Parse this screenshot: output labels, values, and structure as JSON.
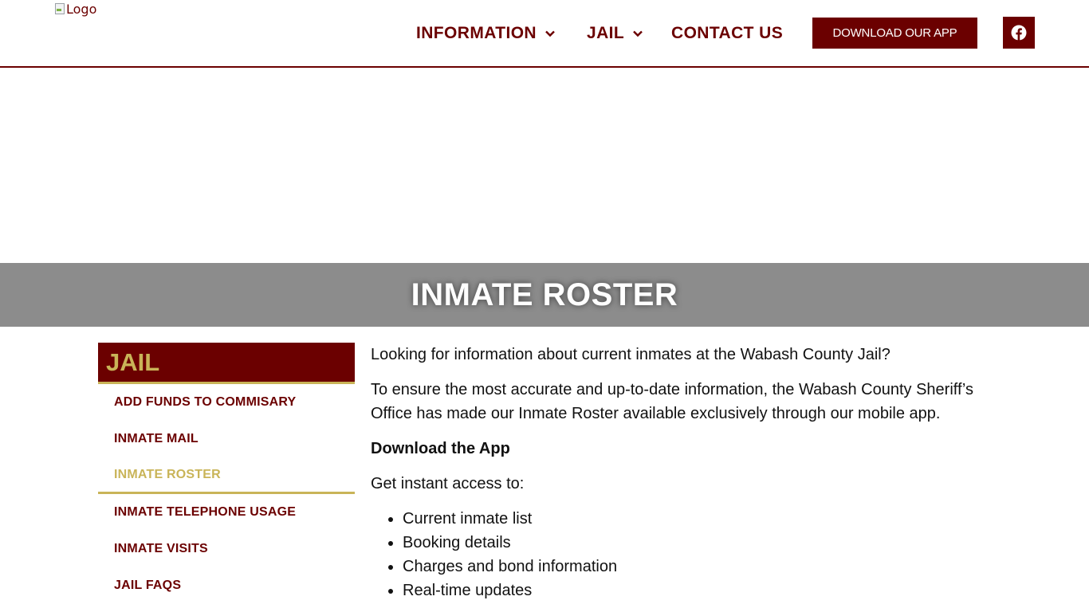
{
  "header": {
    "logo_alt": "Logo",
    "nav": {
      "information": "INFORMATION",
      "jail": "JAIL",
      "contact": "CONTACT US"
    },
    "download_button": "DOWNLOAD OUR APP",
    "social_icon": "facebook-icon"
  },
  "banner": {
    "title": "INMATE ROSTER"
  },
  "sidebar": {
    "heading": "JAIL",
    "items": [
      {
        "label": "ADD FUNDS TO COMMISARY"
      },
      {
        "label": "INMATE MAIL"
      },
      {
        "label": "INMATE ROSTER",
        "active": true
      },
      {
        "label": "INMATE TELEPHONE USAGE"
      },
      {
        "label": "INMATE VISITS"
      },
      {
        "label": "JAIL FAQS"
      }
    ]
  },
  "content": {
    "intro": "Looking for information about current inmates at the Wabash County Jail?",
    "body": "To ensure the most accurate and up-to-date information, the Wabash County Sheriff’s Office has made our Inmate Roster available exclusively through our mobile app.",
    "download_heading": "Download the App",
    "access_intro": "Get instant access to:",
    "features": [
      "Current inmate list",
      "Booking details",
      "Charges and bond information",
      "Real-time updates"
    ]
  },
  "colors": {
    "brand": "#6b0000",
    "accent": "#c9b458",
    "banner": "#8c8c8c"
  }
}
